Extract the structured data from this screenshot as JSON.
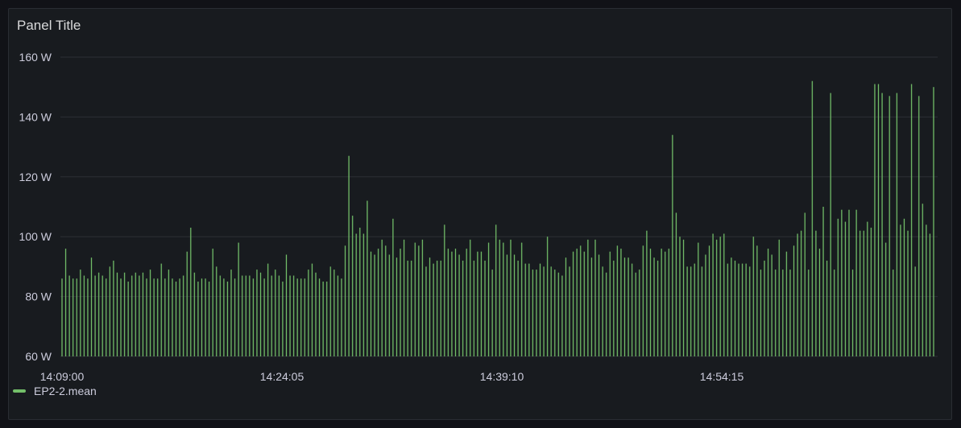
{
  "panel": {
    "title": "Panel Title"
  },
  "colors": {
    "background": "#111217",
    "panel_bg": "#181b1f",
    "grid": "#2c2f35",
    "text": "#ccccdc",
    "series": "#73bf69"
  },
  "chart_data": {
    "type": "bar",
    "title": "Panel Title",
    "xlabel": "",
    "ylabel": "",
    "y_unit": "W",
    "ylim": [
      60,
      160
    ],
    "yticks": [
      60,
      80,
      100,
      120,
      140,
      160
    ],
    "ytick_labels": [
      "60 W",
      "80 W",
      "100 W",
      "120 W",
      "140 W",
      "160 W"
    ],
    "xticks": [
      "14:09:00",
      "14:24:05",
      "14:39:10",
      "14:54:15"
    ],
    "grid": true,
    "legend_position": "bottom-left",
    "series": [
      {
        "name": "EP2-2.mean",
        "values": [
          86,
          96,
          87,
          86,
          86,
          89,
          87,
          86,
          93,
          87,
          88,
          87,
          86,
          90,
          92,
          88,
          86,
          88,
          85,
          87,
          88,
          87,
          88,
          86,
          89,
          86,
          86,
          91,
          86,
          89,
          86,
          85,
          86,
          87,
          95,
          103,
          88,
          85,
          86,
          86,
          85,
          96,
          90,
          87,
          86,
          85,
          89,
          86,
          98,
          87,
          87,
          87,
          86,
          89,
          88,
          86,
          91,
          87,
          89,
          87,
          85,
          94,
          87,
          87,
          86,
          86,
          86,
          89,
          91,
          88,
          86,
          85,
          85,
          90,
          89,
          87,
          86,
          97,
          127,
          107,
          101,
          103,
          101,
          112,
          95,
          94,
          96,
          99,
          97,
          94,
          106,
          93,
          96,
          99,
          92,
          92,
          98,
          97,
          99,
          90,
          93,
          91,
          92,
          92,
          104,
          96,
          95,
          96,
          94,
          92,
          96,
          99,
          92,
          95,
          95,
          92,
          98,
          89,
          104,
          99,
          98,
          94,
          99,
          94,
          92,
          98,
          91,
          91,
          89,
          89,
          91,
          90,
          100,
          90,
          89,
          88,
          87,
          93,
          90,
          95,
          96,
          97,
          95,
          99,
          93,
          99,
          94,
          90,
          88,
          95,
          92,
          97,
          96,
          93,
          93,
          91,
          88,
          89,
          97,
          102,
          96,
          93,
          92,
          96,
          95,
          96,
          134,
          108,
          100,
          99,
          90,
          90,
          91,
          98,
          90,
          94,
          97,
          101,
          99,
          100,
          101,
          91,
          93,
          92,
          91,
          91,
          91,
          90,
          100,
          97,
          89,
          92,
          96,
          94,
          89,
          99,
          89,
          95,
          89,
          97,
          101,
          102,
          108,
          89,
          152,
          102,
          96,
          110,
          92,
          148,
          89,
          106,
          109,
          105,
          109,
          89,
          109,
          102,
          102,
          105,
          103,
          151,
          151,
          148,
          98,
          147,
          89,
          148,
          104,
          106,
          102,
          151,
          90,
          147,
          111,
          104,
          101,
          150
        ]
      }
    ]
  },
  "legend": {
    "items": [
      {
        "label": "EP2-2.mean",
        "color": "#73bf69"
      }
    ]
  }
}
